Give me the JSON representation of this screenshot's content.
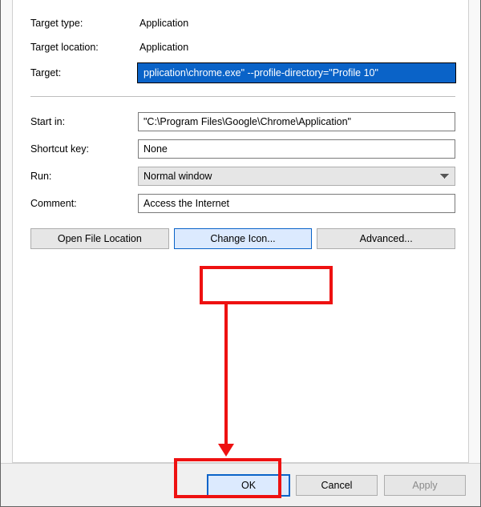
{
  "labels": {
    "target_type": "Target type:",
    "target_location": "Target location:",
    "target": "Target:",
    "start_in": "Start in:",
    "shortcut_key": "Shortcut key:",
    "run": "Run:",
    "comment": "Comment:"
  },
  "values": {
    "target_type": "Application",
    "target_location": "Application",
    "target": "pplication\\chrome.exe\" --profile-directory=\"Profile 10\"",
    "start_in": "\"C:\\Program Files\\Google\\Chrome\\Application\"",
    "shortcut_key": "None",
    "run": "Normal window",
    "comment": "Access the Internet"
  },
  "buttons": {
    "open_file_location": "Open File Location",
    "change_icon": "Change Icon...",
    "advanced": "Advanced...",
    "ok": "OK",
    "cancel": "Cancel",
    "apply": "Apply"
  }
}
